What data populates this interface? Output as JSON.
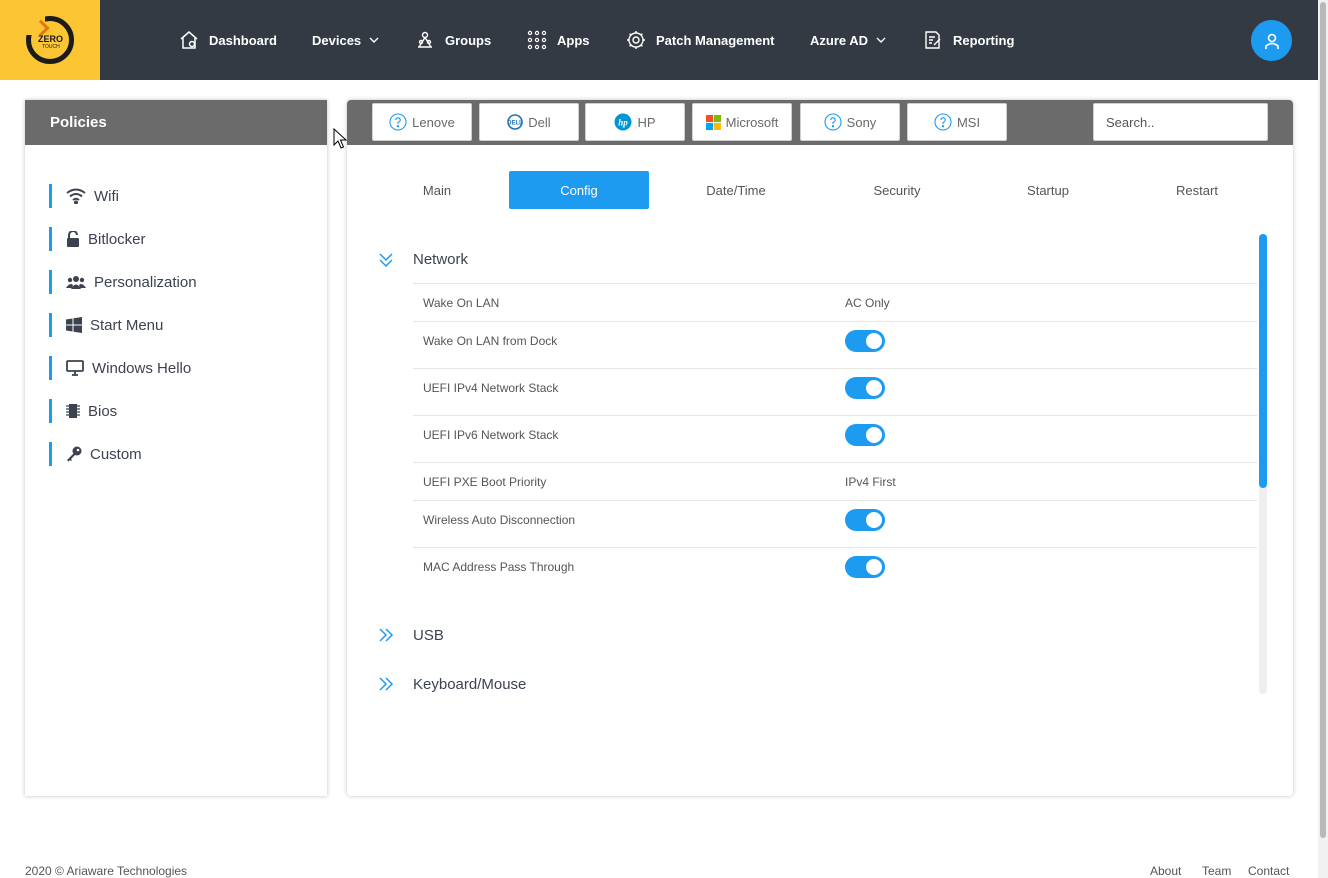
{
  "logo": {
    "text": "ZERO",
    "sub": "TOUCH"
  },
  "nav": {
    "items": [
      {
        "label": "Dashboard",
        "icon": "home-icon"
      },
      {
        "label": "Devices",
        "icon": "chevron-down-icon"
      },
      {
        "label": "Groups",
        "icon": "groups-icon"
      },
      {
        "label": "Apps",
        "icon": "apps-grid-icon"
      },
      {
        "label": "Patch Management",
        "icon": "gear-icon"
      },
      {
        "label": "Azure AD",
        "icon": "chevron-down-icon"
      },
      {
        "label": "Reporting",
        "icon": "report-icon"
      }
    ]
  },
  "sidebar": {
    "title": "Policies",
    "items": [
      {
        "label": "Wifi",
        "icon": "wifi-icon"
      },
      {
        "label": "Bitlocker",
        "icon": "unlock-icon"
      },
      {
        "label": "Personalization",
        "icon": "users-icon"
      },
      {
        "label": "Start Menu",
        "icon": "windows-icon"
      },
      {
        "label": "Windows Hello",
        "icon": "monitor-icon"
      },
      {
        "label": "Bios",
        "icon": "chip-icon"
      },
      {
        "label": "Custom",
        "icon": "key-icon"
      }
    ]
  },
  "brands": [
    {
      "label": "Lenove",
      "icon": "question-circle-icon"
    },
    {
      "label": "Dell",
      "icon": "dell-logo-icon"
    },
    {
      "label": "HP",
      "icon": "hp-logo-icon"
    },
    {
      "label": "Microsoft",
      "icon": "microsoft-logo-icon"
    },
    {
      "label": "Sony",
      "icon": "question-circle-icon"
    },
    {
      "label": "MSI",
      "icon": "question-circle-icon"
    }
  ],
  "search": {
    "placeholder": "Search.."
  },
  "tabs": [
    {
      "label": "Main",
      "active": false
    },
    {
      "label": "Config",
      "active": true
    },
    {
      "label": "Date/Time",
      "active": false
    },
    {
      "label": "Security",
      "active": false
    },
    {
      "label": "Startup",
      "active": false
    },
    {
      "label": "Restart",
      "active": false
    }
  ],
  "sections": {
    "network": {
      "title": "Network",
      "expanded": true,
      "rows": [
        {
          "label": "Wake On LAN",
          "type": "text",
          "value": "AC Only"
        },
        {
          "label": "Wake On LAN from Dock",
          "type": "toggle",
          "value": true
        },
        {
          "label": "UEFI IPv4 Network Stack",
          "type": "toggle",
          "value": true
        },
        {
          "label": "UEFI IPv6 Network Stack",
          "type": "toggle",
          "value": true
        },
        {
          "label": "UEFI PXE Boot Priority",
          "type": "text",
          "value": "IPv4 First"
        },
        {
          "label": "Wireless Auto Disconnection",
          "type": "toggle",
          "value": true
        },
        {
          "label": "MAC Address Pass Through",
          "type": "toggle",
          "value": true
        }
      ]
    },
    "usb": {
      "title": "USB",
      "expanded": false
    },
    "keyboard": {
      "title": "Keyboard/Mouse",
      "expanded": false
    }
  },
  "footer": {
    "copyright": "2020 © Ariaware Technologies",
    "links": [
      "About",
      "Team",
      "Contact"
    ]
  },
  "colors": {
    "accent": "#1d9bf0",
    "topbar": "#333a44",
    "logo_bg": "#fbc533",
    "panel_header": "#6b6b6b"
  }
}
